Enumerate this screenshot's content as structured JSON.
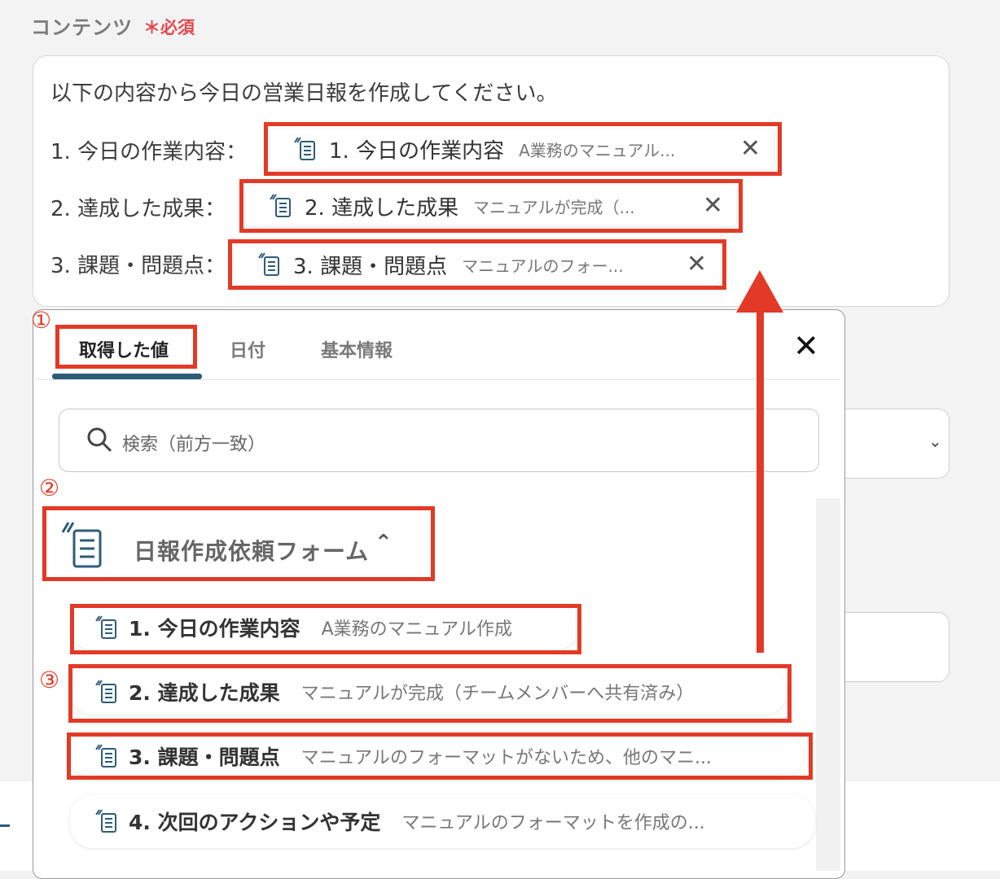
{
  "field": {
    "label": "コンテンツ",
    "required": "＊必須"
  },
  "content": {
    "intro": "以下の内容から今日の営業日報を作成してください。",
    "lines": [
      {
        "label": "1. 今日の作業内容：",
        "chip_title": "1. 今日の作業内容",
        "chip_value": "A業務のマニュアル..."
      },
      {
        "label": "2. 達成した成果：",
        "chip_title": "2. 達成した成果",
        "chip_value": "マニュアルが完成（..."
      },
      {
        "label": "3. 課題・問題点：",
        "chip_title": "3. 課題・問題点",
        "chip_value": "マニュアルのフォー..."
      }
    ],
    "remove_glyph": "✕"
  },
  "picker": {
    "tabs": [
      {
        "label": "取得した値",
        "active": true
      },
      {
        "label": "日付",
        "active": false
      },
      {
        "label": "基本情報",
        "active": false
      }
    ],
    "close_glyph": "✕",
    "search_placeholder": "検索（前方一致）",
    "group": {
      "title": "日報作成依頼フォーム",
      "caret": "⌃"
    },
    "items": [
      {
        "title": "1. 今日の作業内容",
        "value": "A業務のマニュアル作成"
      },
      {
        "title": "2. 達成した成果",
        "value": "マニュアルが完成（チームメンバーへ共有済み）"
      },
      {
        "title": "3. 課題・問題点",
        "value": "マニュアルのフォーマットがないため、他のマニ..."
      },
      {
        "title": "4. 次回のアクションや予定",
        "value": "マニュアルのフォーマットを作成の..."
      }
    ]
  },
  "annotations": {
    "m1": "①",
    "m2": "②",
    "m3": "③"
  },
  "colors": {
    "annotation_red": "#e23a26",
    "accent": "#2d5c78",
    "required_red": "#e5484d"
  },
  "icons": [
    "form-icon",
    "close-icon",
    "search-icon",
    "chevron-up-icon",
    "chevron-down-icon"
  ],
  "background_select": {
    "chevron": "⌄"
  }
}
